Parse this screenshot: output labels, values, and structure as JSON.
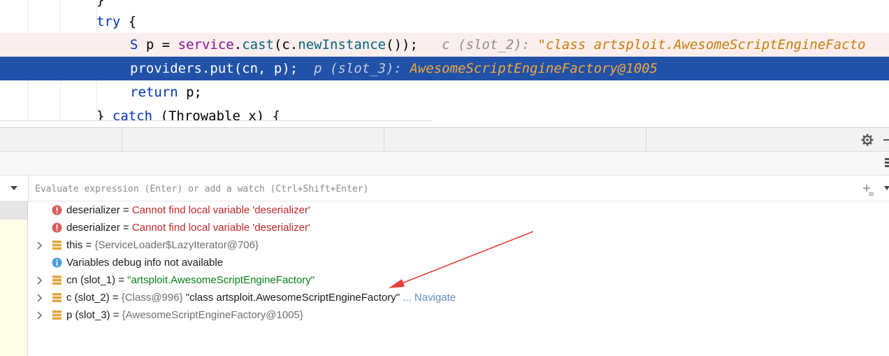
{
  "editor": {
    "lines": [
      {
        "kind": "brace",
        "text": "}"
      },
      {
        "kind": "try",
        "kw": "try",
        "rest": " {"
      },
      {
        "kind": "cast",
        "type": "S",
        "a": " p = ",
        "field": "service",
        "b": ".",
        "call": "cast",
        "c": "(c.",
        "call2": "newInstance",
        "d": "());",
        "hint": "c (slot_2): ",
        "hint_val": "\"class artsploit.AwesomeScriptEngineFacto"
      },
      {
        "kind": "put",
        "field": "providers",
        "b": ".",
        "call": "put",
        "c": "(cn, p);",
        "hint": "p (slot_3): ",
        "hint_val": "AwesomeScriptEngineFactory@1005"
      },
      {
        "kind": "ret",
        "kw": "return",
        "rest": " p;"
      },
      {
        "kind": "catch",
        "a": "} ",
        "kw": "catch",
        "rest": " (Throwable x) {"
      }
    ]
  },
  "watch": {
    "placeholder": "Evaluate expression (Enter) or add a watch (Ctrl+Shift+Enter)"
  },
  "variables": [
    {
      "icon": "error-icon",
      "name": "deserializer",
      "eq": " = ",
      "value": "Cannot find local variable 'deserializer'",
      "style": "err",
      "expandable": false
    },
    {
      "icon": "error-icon",
      "name": "deserializer",
      "eq": " = ",
      "value": "Cannot find local variable 'deserializer'",
      "style": "err",
      "expandable": false
    },
    {
      "icon": "field-icon",
      "name": "this",
      "eq": " = ",
      "value": "{ServiceLoader$LazyIterator@706}",
      "style": "obj",
      "expandable": true
    },
    {
      "icon": "info-icon",
      "name": "Variables debug info not available",
      "eq": "",
      "value": "",
      "style": "plain",
      "expandable": false
    },
    {
      "icon": "field-icon",
      "name": "cn (slot_1)",
      "eq": " = ",
      "value": "\"artsploit.AwesomeScriptEngineFactory\"",
      "style": "str",
      "expandable": true
    },
    {
      "icon": "field-icon",
      "name": "c (slot_2)",
      "eq": " = ",
      "value": "{Class@996}",
      "value2": " \"class artsploit.AwesomeScriptEngineFactory\"",
      "nav": " ... Navigate",
      "style": "obj",
      "expandable": true
    },
    {
      "icon": "field-icon",
      "name": "p (slot_3)",
      "eq": " = ",
      "value": "{AwesomeScriptEngineFactory@1005}",
      "style": "obj",
      "expandable": true
    }
  ],
  "colors": {
    "selection": "#2151a8",
    "error_line": "#fbeeec",
    "error_text": "#c12727",
    "string_text": "#067d17",
    "annotation_arrow": "#e8403a"
  }
}
